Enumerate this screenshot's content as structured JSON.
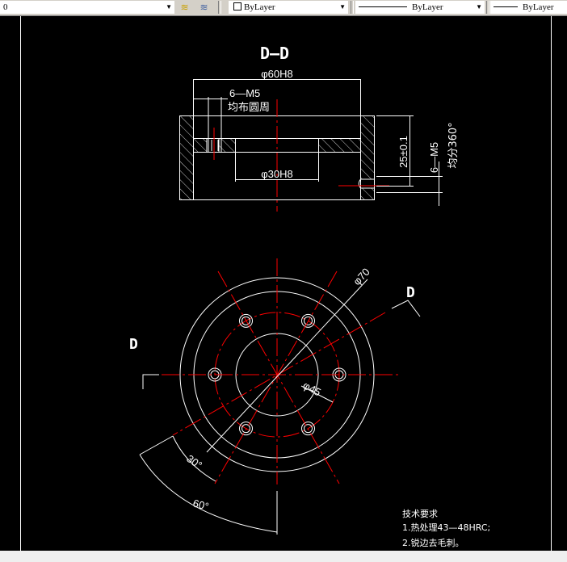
{
  "toolbar": {
    "layer_value": "0",
    "color_value": "ByLayer",
    "linetype_value": "ByLayer",
    "lineweight_value": "ByLayer"
  },
  "drawing": {
    "section_title": "D—D",
    "dim_outer_bore": "φ60H8",
    "dim_thread_top": "6—M5",
    "dim_thread_top_note": "均布圆周",
    "dim_inner_bore": "φ30H8",
    "dim_height": "25±0.1",
    "dim_side_thread": "6—M5",
    "dim_side_thread_note": "均分360°",
    "dim_dia70": "φ70",
    "dim_dia45": "φ45",
    "angle_30": "30°",
    "angle_60": "60°",
    "section_mark_left": "D",
    "section_mark_right": "D"
  },
  "notes": {
    "title": "技术要求",
    "line1": "1.热处理43—48HRC;",
    "line2": "2.锐边去毛刺。"
  },
  "colors": {
    "line": "#ffffff",
    "center": "#ff0000",
    "background": "#000000"
  }
}
